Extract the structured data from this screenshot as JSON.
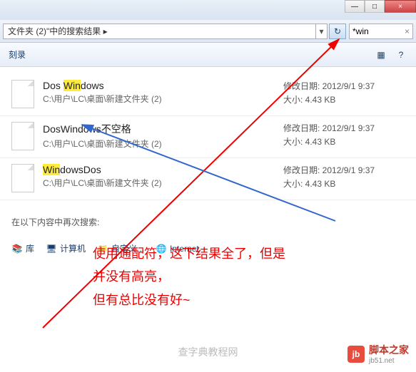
{
  "window": {
    "minimize": "—",
    "maximize": "□",
    "close": "×"
  },
  "address": {
    "path": "文件夹 (2)\"中的搜索结果  ▸",
    "dropdown": "▾",
    "refresh": "↻"
  },
  "search": {
    "query": "*win",
    "clear": "×"
  },
  "toolbar": {
    "save_search": "刻录",
    "view_icon": "▦",
    "help_icon": "?"
  },
  "files": [
    {
      "name_parts": [
        "Dos ",
        "Win",
        "dows"
      ],
      "path": "C:\\用户\\LC\\桌面\\新建文件夹 (2)",
      "date_label": "修改日期:",
      "date": "2012/9/1 9:37",
      "size_label": "大小:",
      "size": "4.43 KB",
      "highlight_indices": [
        1
      ]
    },
    {
      "name_parts": [
        "DosWindows不空格"
      ],
      "path": "C:\\用户\\LC\\桌面\\新建文件夹 (2)",
      "date_label": "修改日期:",
      "date": "2012/9/1 9:37",
      "size_label": "大小:",
      "size": "4.43 KB",
      "highlight_indices": []
    },
    {
      "name_parts": [
        "Win",
        "dowsDos"
      ],
      "path": "C:\\用户\\LC\\桌面\\新建文件夹 (2)",
      "date_label": "修改日期:",
      "date": "2012/9/1 9:37",
      "size_label": "大小:",
      "size": "4.43 KB",
      "highlight_indices": [
        0
      ]
    }
  ],
  "search_again": {
    "label": "在以下内容中再次搜索:",
    "options": {
      "libraries": "库",
      "computer": "计算机",
      "custom": "自定义...",
      "internet": "Internet"
    }
  },
  "annotation": {
    "line1": "使用通配符，这下结果全了，但是",
    "line2": "并没有高亮，",
    "line3": "但有总比没有好~"
  },
  "watermark": {
    "logo": "jb",
    "text": "脚本之家",
    "sub": "jb51.net"
  },
  "watermark2": "查字典教程网"
}
